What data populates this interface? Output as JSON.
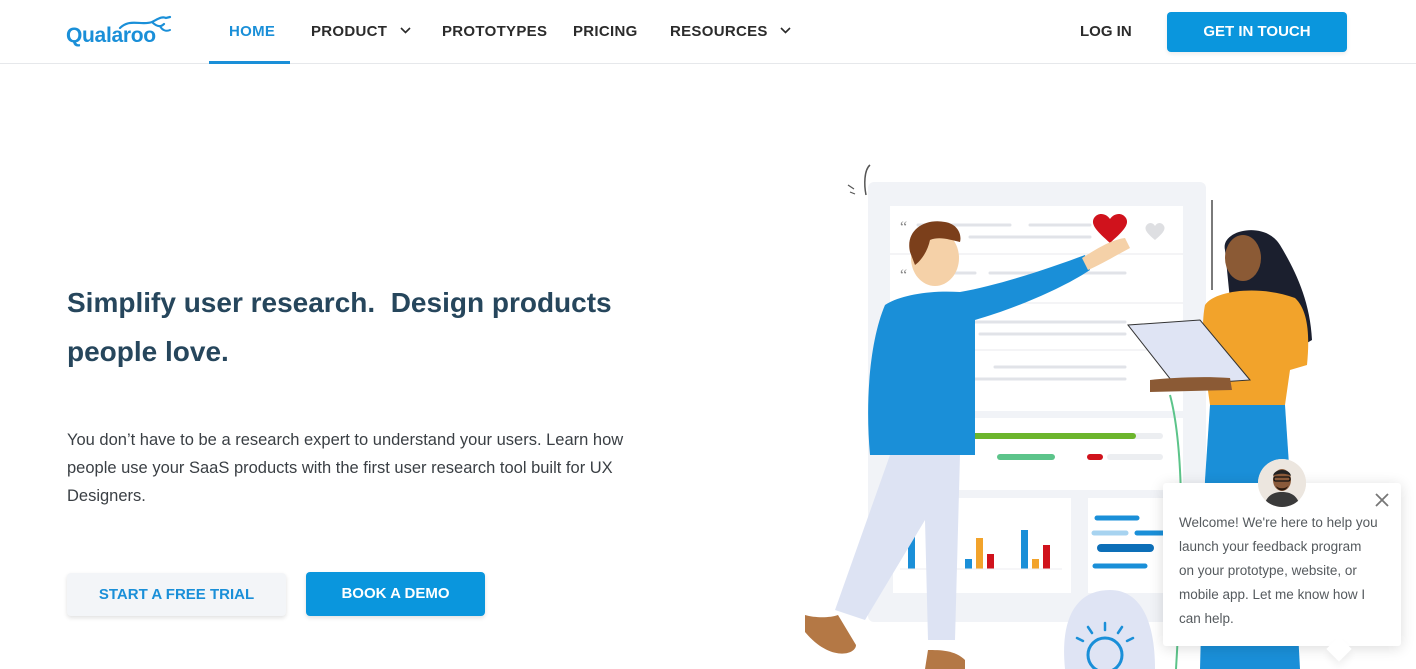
{
  "brand": {
    "name": "Qualaroo",
    "accent": "#1a8fd8",
    "button_blue": "#0a96dd",
    "heading_color": "#26465c"
  },
  "nav": {
    "items": [
      {
        "label": "HOME",
        "active": true,
        "has_dropdown": false
      },
      {
        "label": "PRODUCT",
        "active": false,
        "has_dropdown": true
      },
      {
        "label": "PROTOTYPES",
        "active": false,
        "has_dropdown": false
      },
      {
        "label": "PRICING",
        "active": false,
        "has_dropdown": false
      },
      {
        "label": "RESOURCES",
        "active": false,
        "has_dropdown": true
      }
    ],
    "login_label": "LOG IN",
    "cta_label": "GET IN TOUCH"
  },
  "hero": {
    "title_line1": "Simplify user research.  Design products",
    "title_line2": "people love.",
    "description": "You don’t have to be a research expert to understand your users. Learn how people use your SaaS products with the first user research tool built for UX Designers.",
    "primary_button": "START A FREE TRIAL",
    "secondary_button": "BOOK A DEMO"
  },
  "illustration": {
    "icons": [
      "heart-icon",
      "quote-icon",
      "bar-chart-icon",
      "globe-icon"
    ],
    "colors": {
      "blue": "#1a8fd8",
      "orange": "#f2a32b",
      "red": "#d0121c",
      "green": "#6cb52c",
      "mint": "#5cc48a"
    }
  },
  "chat_widget": {
    "message": "Welcome! We're here to help you launch your feedback program on your prototype, website, or mobile app. Let me know how I can help.",
    "close_icon": "close-icon"
  }
}
